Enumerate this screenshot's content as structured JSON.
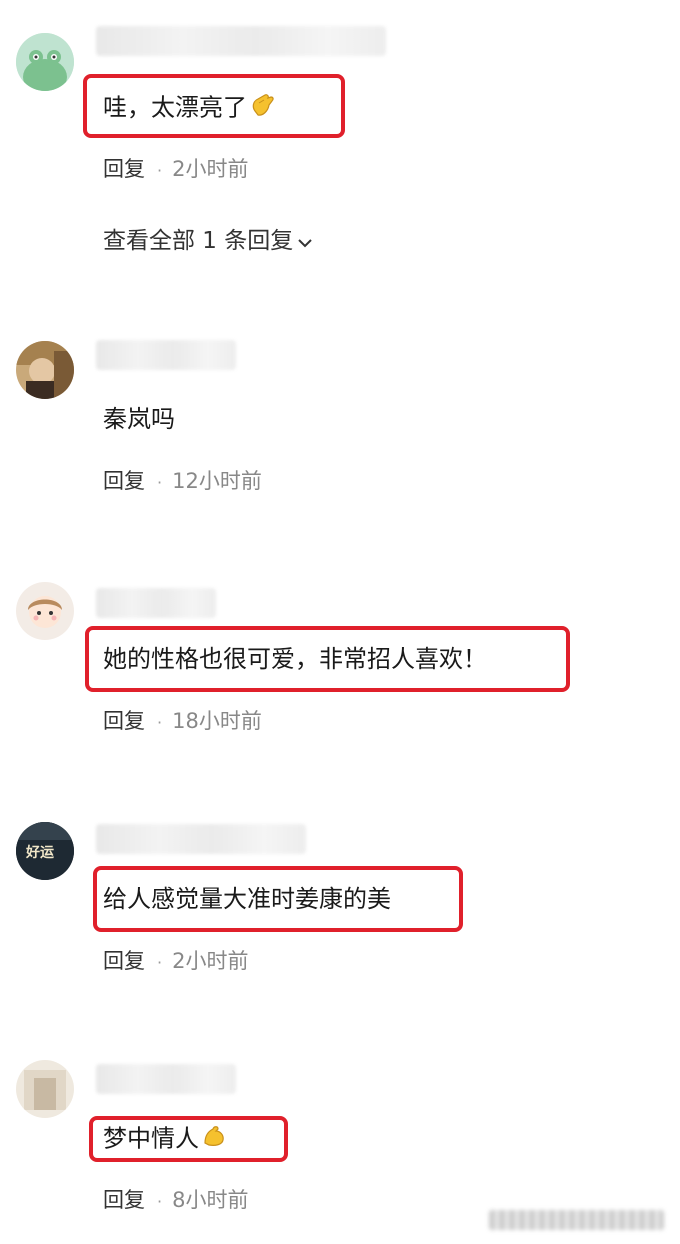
{
  "comments": [
    {
      "text": "哇，太漂亮了",
      "emoji": "clapping-hand-emoji",
      "reply_label": "回复",
      "time": "2小时前",
      "view_replies": "查看全部 1 条回复"
    },
    {
      "text": "秦岚吗",
      "reply_label": "回复",
      "time": "12小时前"
    },
    {
      "text": "她的性格也很可爱，非常招人喜欢！",
      "reply_label": "回复",
      "time": "18小时前"
    },
    {
      "text": "给人感觉量大准时姜康的美",
      "avatar_text": "好运",
      "reply_label": "回复",
      "time": "2小时前"
    },
    {
      "text": "梦中情人",
      "emoji": "flexed-biceps-emoji",
      "reply_label": "回复",
      "time": "8小时前"
    }
  ],
  "colors": {
    "highlight": "#e0202b",
    "meta_gray": "#888888",
    "emoji_yellow": "#f5c12e"
  }
}
